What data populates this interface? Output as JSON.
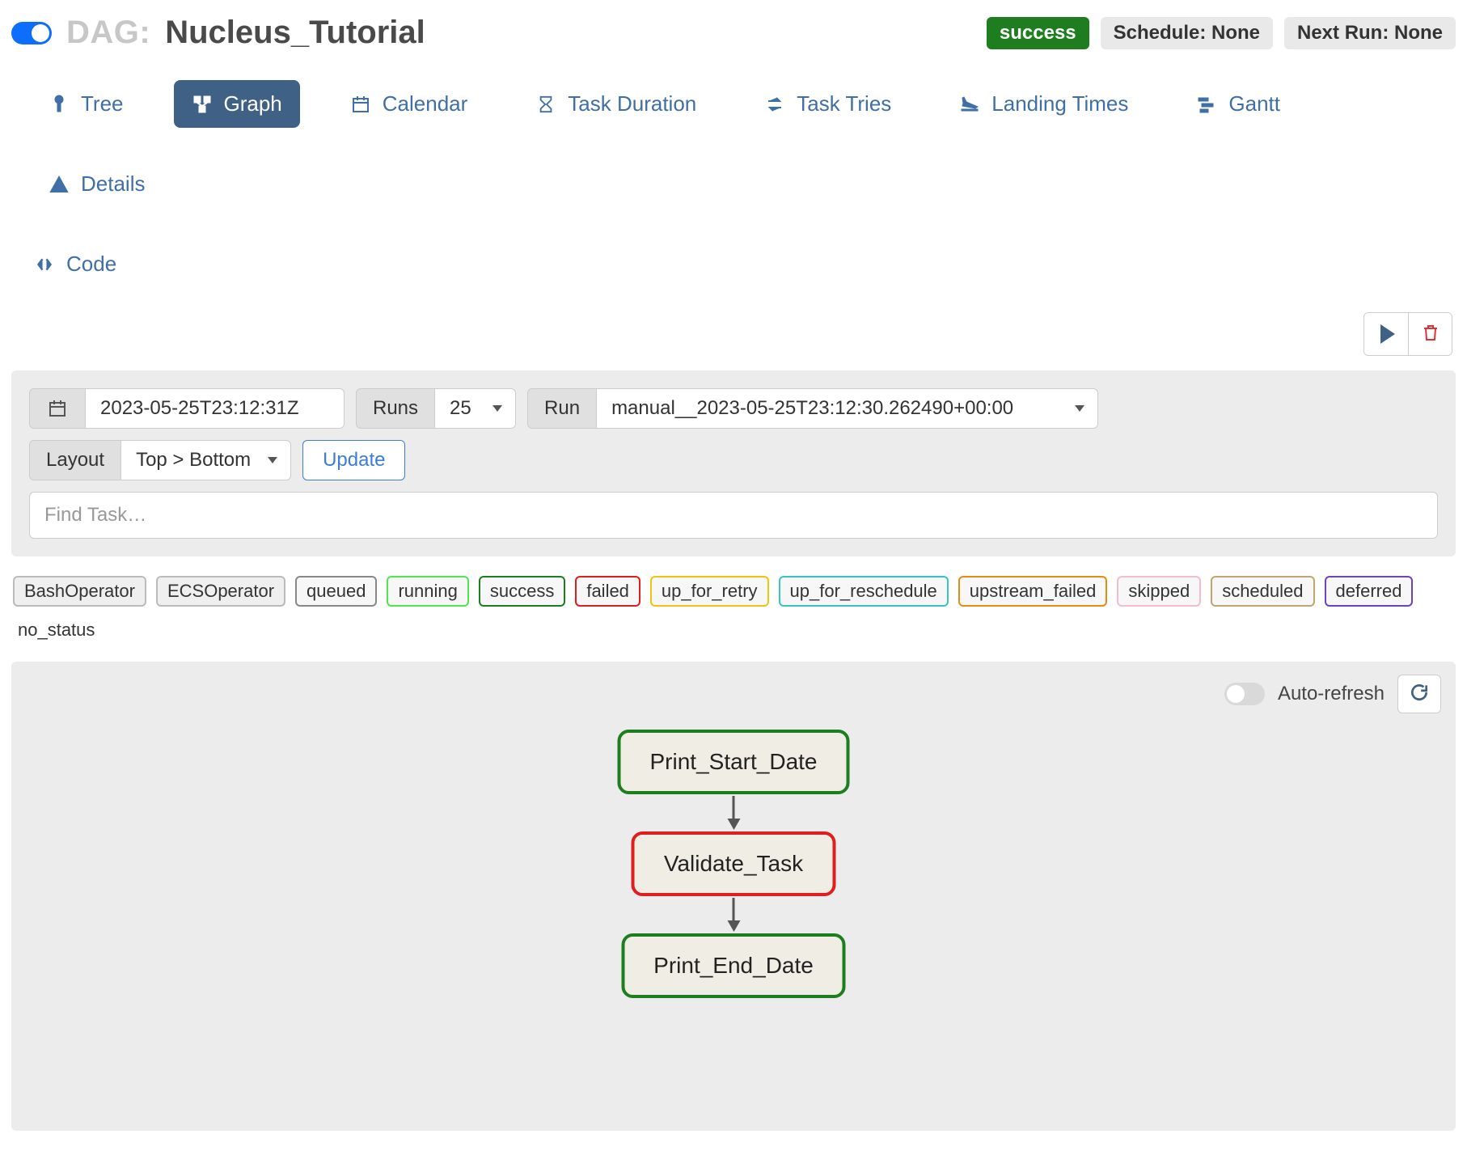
{
  "header": {
    "dag_label": "DAG:",
    "dag_name": "Nucleus_Tutorial",
    "status_badge": "success",
    "schedule_badge": "Schedule: None",
    "next_run_badge": "Next Run: None"
  },
  "tabs": {
    "tree": "Tree",
    "graph": "Graph",
    "calendar": "Calendar",
    "task_duration": "Task Duration",
    "task_tries": "Task Tries",
    "landing_times": "Landing Times",
    "gantt": "Gantt",
    "details": "Details",
    "code": "Code"
  },
  "controls": {
    "date_value": "2023-05-25T23:12:31Z",
    "runs_label": "Runs",
    "runs_value": "25",
    "run_label": "Run",
    "run_value": "manual__2023-05-25T23:12:30.262490+00:00",
    "layout_label": "Layout",
    "layout_value": "Top > Bottom",
    "update_btn": "Update",
    "find_placeholder": "Find Task…"
  },
  "legend": {
    "operators": [
      "BashOperator",
      "ECSOperator"
    ],
    "statuses": {
      "queued": "queued",
      "running": "running",
      "success": "success",
      "failed": "failed",
      "up_for_retry": "up_for_retry",
      "up_for_reschedule": "up_for_reschedule",
      "upstream_failed": "upstream_failed",
      "skipped": "skipped",
      "scheduled": "scheduled",
      "deferred": "deferred",
      "no_status": "no_status"
    }
  },
  "graph": {
    "auto_refresh_label": "Auto-refresh",
    "nodes": {
      "n1": "Print_Start_Date",
      "n2": "Validate_Task",
      "n3": "Print_End_Date"
    }
  }
}
